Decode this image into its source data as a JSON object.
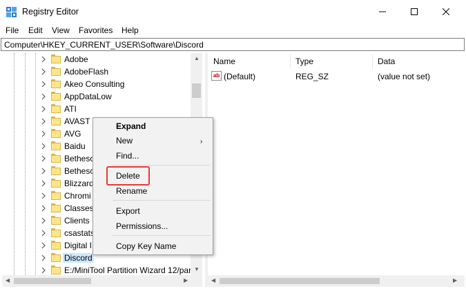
{
  "window": {
    "title": "Registry Editor"
  },
  "menu": [
    "File",
    "Edit",
    "View",
    "Favorites",
    "Help"
  ],
  "address": "Computer\\HKEY_CURRENT_USER\\Software\\Discord",
  "tree": {
    "items": [
      "Adobe",
      "AdobeFlash",
      "Akeo Consulting",
      "AppDataLow",
      "ATI",
      "AVAST S",
      "AVG",
      "Baidu",
      "Bethesc",
      "Bethesc",
      "Blizzard",
      "Chromi",
      "Classes",
      "Clients",
      "csastats",
      "Digital I",
      "Discord",
      "E:/MiniTool Partition Wizard 12/par"
    ],
    "selected": "Discord"
  },
  "list": {
    "columns": [
      "Name",
      "Type",
      "Data"
    ],
    "rows": [
      {
        "name": "(Default)",
        "type": "REG_SZ",
        "data": "(value not set)",
        "icon": "string-value-icon"
      }
    ]
  },
  "context_menu": {
    "items": [
      "Expand",
      "New",
      "Find...",
      "Delete",
      "Rename",
      "Export",
      "Permissions...",
      "Copy Key Name"
    ],
    "highlighted": "Delete",
    "highlight_color": "#e53935"
  },
  "colors": {
    "selection": "#cce8ff",
    "folder": "#fde58a"
  }
}
